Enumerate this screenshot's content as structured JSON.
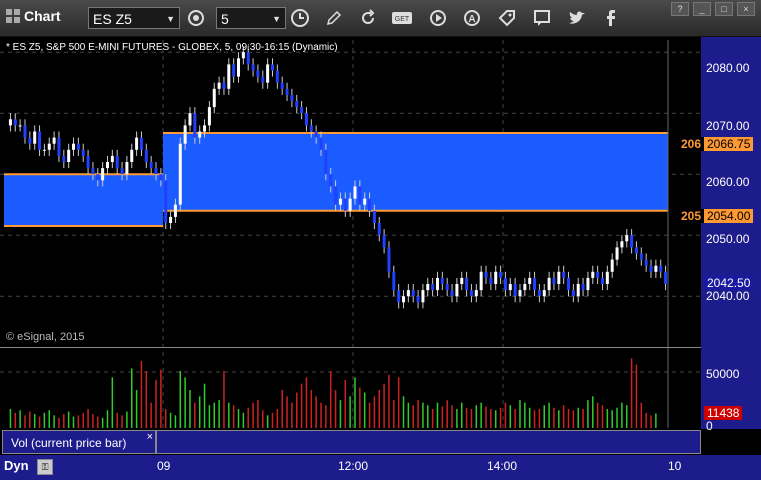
{
  "toolbar": {
    "title": "Chart",
    "symbol": "ES Z5",
    "interval": "5",
    "icons": [
      "grid-icon",
      "settings-cog-icon",
      "clock-icon",
      "pencil-icon",
      "refresh-icon",
      "get-icon",
      "play-icon",
      "alert-icon",
      "tag-icon",
      "chat-icon",
      "twitter-icon",
      "facebook-icon"
    ],
    "window_buttons": [
      "?",
      "_",
      "□",
      "×"
    ]
  },
  "chart": {
    "header": "* ES Z5, S&P 500 E-MINI FUTURES - GLOBEX, 5, 09:30-16:15 (Dynamic)",
    "copyright": "© eSignal, 2015",
    "price_labels": [
      "2080.00",
      "2070.00",
      "2060.00",
      "2050.00",
      "2040.00"
    ],
    "volume_labels": [
      "50000",
      "0"
    ],
    "time_labels": [
      "09",
      "12:00",
      "14:00",
      "10"
    ],
    "last_price": "2042.50",
    "last_volume": "11438",
    "upper_level": "2066.75",
    "lower_level": "2054.00",
    "upper_level_clip": "206",
    "lower_level_clip": "205",
    "vol_title": "Vol (current price bar)",
    "vol_close": "×",
    "dyn": "Dyn",
    "colors": {
      "band": "#1a5cff",
      "level_line": "#ff9933",
      "axis_bg": "#1c1c8c",
      "up_bar": "#ffffff",
      "down_bar": "#2040ff",
      "vol_up": "#2ecc2e",
      "vol_down": "#cc2222",
      "last_price_bg": "#1a1aa0",
      "last_vol_bg": "#cc0000"
    }
  },
  "chart_data": {
    "type": "candlestick",
    "title": "ES Z5, S&P 500 E-MINI FUTURES - GLOBEX, 5, 09:30-16:15 (Dynamic)",
    "ylim": [
      2032,
      2082
    ],
    "levels": [
      2066.75,
      2054.0
    ],
    "prev_levels": [
      2060.0,
      2051.5
    ],
    "x_ticks": [
      "09",
      "12:00",
      "14:00",
      "10"
    ],
    "close": [
      2069,
      2068,
      2068,
      2066,
      2065,
      2067,
      2064,
      2064,
      2065,
      2066,
      2063,
      2062,
      2064,
      2065,
      2064,
      2063,
      2061,
      2060,
      2059,
      2061,
      2062,
      2063,
      2061,
      2060,
      2062,
      2064,
      2066,
      2064,
      2062,
      2061,
      2060,
      2059,
      2052,
      2053,
      2055,
      2065,
      2068,
      2070,
      2066,
      2067,
      2068,
      2071,
      2074,
      2075,
      2074,
      2078,
      2076,
      2079,
      2080,
      2078,
      2077,
      2076,
      2075,
      2078,
      2077,
      2075,
      2074,
      2073,
      2072,
      2071,
      2070,
      2068,
      2067,
      2066,
      2064,
      2060,
      2058,
      2055,
      2056,
      2054,
      2056,
      2058,
      2055,
      2056,
      2054,
      2052,
      2050,
      2048,
      2044,
      2041,
      2039,
      2040,
      2041,
      2040,
      2039,
      2041,
      2042,
      2041,
      2043,
      2042,
      2041,
      2040,
      2042,
      2043,
      2041,
      2040,
      2041,
      2044,
      2043,
      2042,
      2044,
      2043,
      2041,
      2042,
      2040,
      2041,
      2042,
      2043,
      2041,
      2040,
      2041,
      2043,
      2042,
      2044,
      2043,
      2041,
      2040,
      2042,
      2041,
      2043,
      2044,
      2043,
      2042,
      2044,
      2046,
      2048,
      2049,
      2050,
      2048,
      2047,
      2046,
      2045,
      2044,
      2045,
      2044,
      2042
    ],
    "volume": [
      15000,
      12000,
      14000,
      10000,
      13000,
      11000,
      9000,
      12000,
      14000,
      10000,
      8000,
      11000,
      13000,
      9000,
      10000,
      12000,
      15000,
      11000,
      9000,
      8000,
      14000,
      40000,
      12000,
      10000,
      13000,
      47000,
      30000,
      53000,
      45000,
      20000,
      38000,
      46000,
      15000,
      12000,
      10000,
      45000,
      40000,
      30000,
      20000,
      25000,
      35000,
      18000,
      20000,
      22000,
      45000,
      20000,
      18000,
      15000,
      12000,
      16000,
      20000,
      22000,
      14000,
      10000,
      12000,
      15000,
      30000,
      25000,
      20000,
      28000,
      35000,
      40000,
      30000,
      25000,
      20000,
      18000,
      45000,
      30000,
      22000,
      38000,
      25000,
      40000,
      32000,
      28000,
      20000,
      25000,
      30000,
      35000,
      42000,
      22000,
      40000,
      25000,
      20000,
      18000,
      22000,
      20000,
      18000,
      15000,
      20000,
      17000,
      22000,
      18000,
      15000,
      20000,
      16000,
      15000,
      18000,
      20000,
      17000,
      15000,
      14000,
      16000,
      20000,
      18000,
      15000,
      22000,
      20000,
      16000,
      14000,
      15000,
      18000,
      20000,
      16000,
      14000,
      18000,
      15000,
      14000,
      16000,
      15000,
      22000,
      25000,
      20000,
      18000,
      15000,
      14000,
      16000,
      20000,
      18000,
      55000,
      50000,
      20000,
      12000,
      10000,
      11438
    ]
  }
}
